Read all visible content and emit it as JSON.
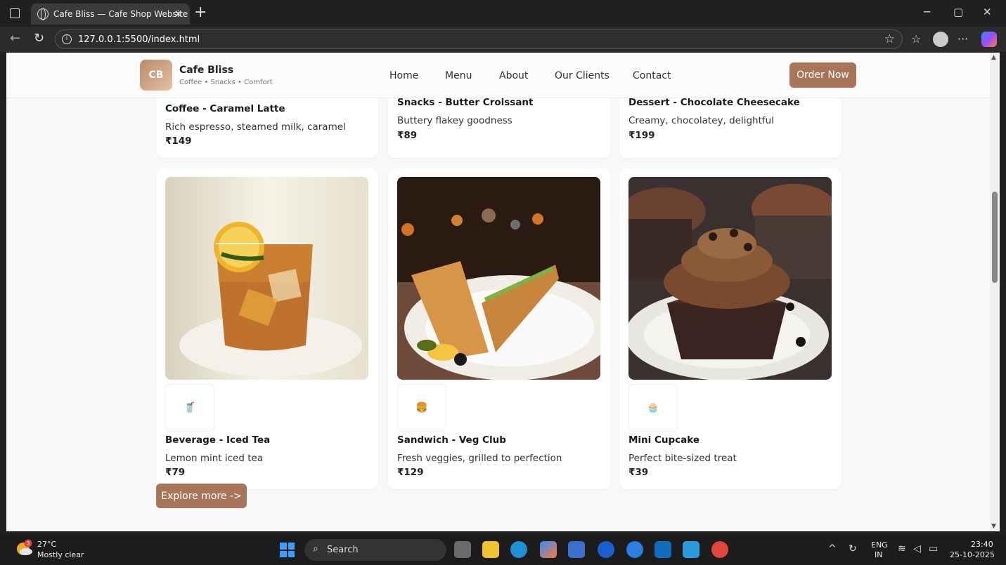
{
  "browser": {
    "tab_title": "Cafe Bliss — Cafe Shop Website",
    "tab_close": "✕",
    "new_tab": "+",
    "url": "127.0.0.1:5500/index.html"
  },
  "site": {
    "logo_initials": "CB",
    "brand_name": "Cafe Bliss",
    "tagline": "Coffee • Snacks • Comfort",
    "nav": [
      "Home",
      "Menu",
      "About",
      "Our Clients",
      "Contact"
    ],
    "order_button": "Order Now",
    "explore_button": "Explore more ->"
  },
  "top_cards": [
    {
      "name": "Coffee - Caramel Latte",
      "desc": "Rich espresso, steamed milk, caramel",
      "price": "₹149"
    },
    {
      "name": "Snacks - Butter Croissant",
      "desc": "Buttery flakey goodness",
      "price": "₹89"
    },
    {
      "name": "Dessert - Chocolate Cheesecake",
      "desc": "Creamy, chocolatey, delightful",
      "price": "₹199"
    }
  ],
  "cards": [
    {
      "name": "Beverage - Iced Tea",
      "desc": "Lemon mint iced tea",
      "price": "₹79",
      "emoji": "🥤"
    },
    {
      "name": "Sandwich - Veg Club",
      "desc": "Fresh veggies, grilled to perfection",
      "price": "₹129",
      "emoji": "🍔"
    },
    {
      "name": "Mini Cupcake",
      "desc": "Perfect bite-sized treat",
      "price": "₹39",
      "emoji": "🧁"
    }
  ],
  "taskbar": {
    "temperature": "27°C",
    "weather": "Mostly clear",
    "weather_badge": "3",
    "search_label": "Search",
    "lang_top": "ENG",
    "lang_bottom": "IN",
    "time": "23:40",
    "date": "25-10-2025"
  },
  "colors": {
    "accent": "#a8755a"
  }
}
